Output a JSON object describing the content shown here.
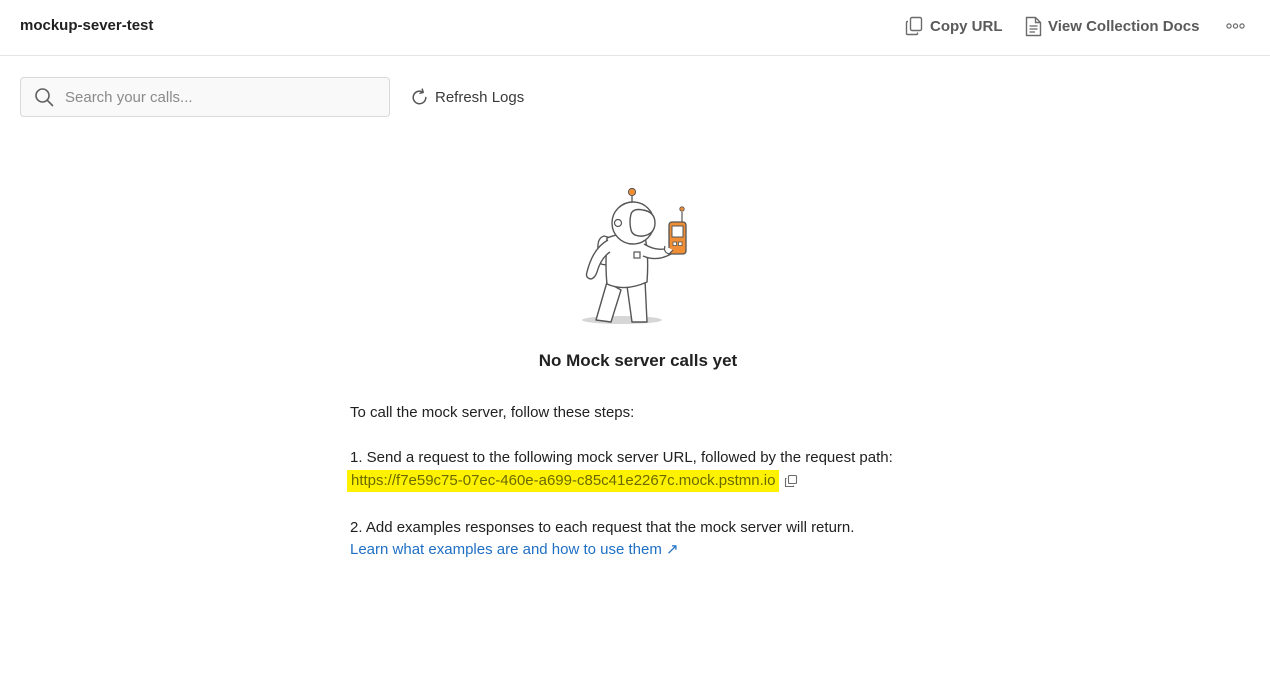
{
  "header": {
    "title": "mockup-sever-test",
    "copy_url_label": "Copy URL",
    "view_docs_label": "View Collection Docs",
    "more_icon": "ellipsis-icon"
  },
  "toolbar": {
    "search_placeholder": "Search your calls...",
    "refresh_label": "Refresh Logs"
  },
  "empty_state": {
    "title": "No Mock server calls yet",
    "intro": "To call the mock server, follow these steps:",
    "step1": "1. Send a request to the following mock server URL, followed by the request path:",
    "mock_url": "https://f7e59c75-07ec-460e-a699-c85c41e2267c.mock.pstmn.io",
    "step2": "2. Add examples responses to each request that the mock server will return.",
    "learn_link": "Learn what examples are and how to use them ↗"
  },
  "colors": {
    "accent_orange": "#f08e36",
    "link_blue": "#1f6fc4",
    "highlight_yellow": "#fff200"
  }
}
